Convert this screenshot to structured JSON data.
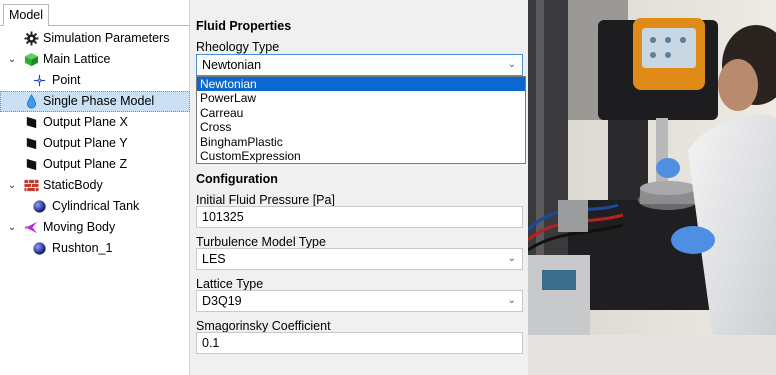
{
  "tree": {
    "tab_label": "Model",
    "items": [
      {
        "label": "Simulation Parameters",
        "icon": "gear-icon"
      },
      {
        "label": "Main Lattice",
        "icon": "green-cube-icon"
      },
      {
        "label": "Point",
        "icon": "point-icon"
      },
      {
        "label": "Single Phase Model",
        "icon": "droplet-icon"
      },
      {
        "label": "Output Plane X",
        "icon": "plane-icon"
      },
      {
        "label": "Output Plane Y",
        "icon": "plane-icon"
      },
      {
        "label": "Output Plane Z",
        "icon": "plane-icon"
      },
      {
        "label": "StaticBody",
        "icon": "brick-wall-icon"
      },
      {
        "label": "Cylindrical Tank",
        "icon": "sphere-icon"
      },
      {
        "label": "Moving Body",
        "icon": "moving-body-icon"
      },
      {
        "label": "Rushton_1",
        "icon": "sphere-icon"
      }
    ]
  },
  "props": {
    "fluid_header": "Fluid Properties",
    "rheology_label": "Rheology Type",
    "rheology_value": "Newtonian",
    "rheology_options": [
      "Newtonian",
      "PowerLaw",
      "Carreau",
      "Cross",
      "BinghamPlastic",
      "CustomExpression"
    ],
    "config_header": "Configuration",
    "pressure_label": "Initial Fluid Pressure [Pa]",
    "pressure_value": "101325",
    "turbulence_label": "Turbulence Model Type",
    "turbulence_value": "LES",
    "lattice_label": "Lattice Type",
    "lattice_value": "D3Q19",
    "smag_label": "Smagorinsky Coefficient",
    "smag_value": "0.1"
  },
  "colors": {
    "selection": "#cce0f4",
    "dropdown_highlight": "#0a68d1",
    "panel_bg": "#f0f0f0",
    "combo_focus": "#4a8fd8"
  }
}
